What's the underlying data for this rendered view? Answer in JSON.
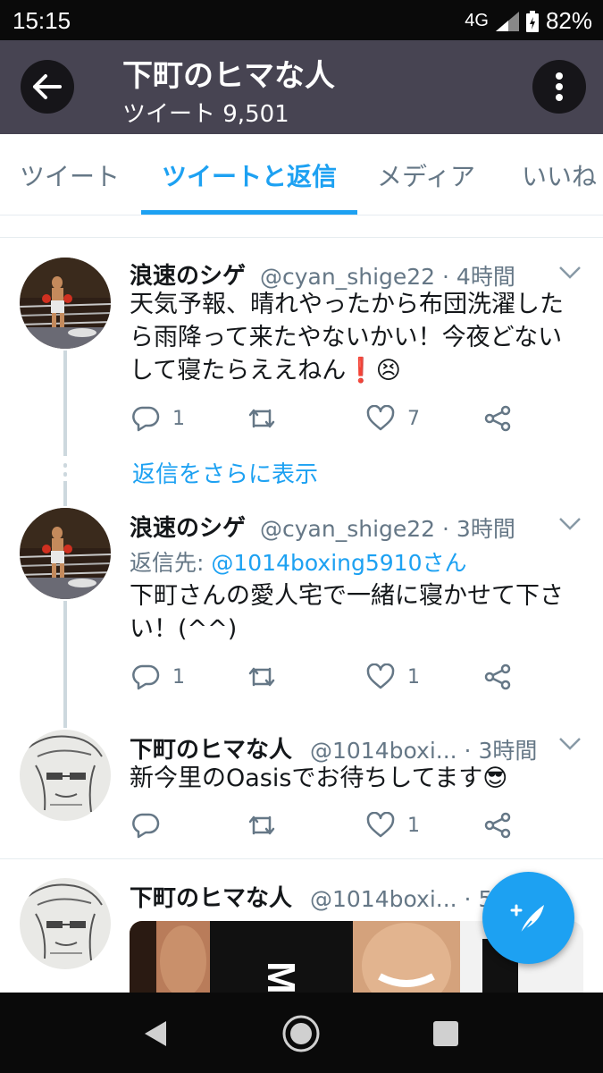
{
  "status_bar": {
    "time": "15:15",
    "network": "4G",
    "battery": "82%"
  },
  "header": {
    "title": "下町のヒマな人",
    "subtitle": "ツイート 9,501"
  },
  "tabs": [
    {
      "label": "ツイート"
    },
    {
      "label": "ツイートと返信"
    },
    {
      "label": "メディア"
    },
    {
      "label": "いいね"
    }
  ],
  "tweets": [
    {
      "name": "浪速のシゲ",
      "handle": "@cyan_shige22 · 4時間",
      "text": "天気予報、晴れやったから布団洗濯したら雨降って来たやないかい！今夜どないして寝たらええねん❗😣",
      "replies": "1",
      "retweets": "",
      "likes": "7"
    },
    {
      "name": "浪速のシゲ",
      "handle": "@cyan_shige22 · 3時間",
      "reply_prefix": "返信先: ",
      "reply_mention": "@1014boxing5910さん",
      "text": "下町さんの愛人宅で一緒に寝かせて下さい！(^^)",
      "replies": "1",
      "retweets": "",
      "likes": "1"
    },
    {
      "name": "下町のヒマな人",
      "handle": "@1014boxi... · 3時間",
      "text": "新今里のOasisでお待ちしてます😎",
      "replies": "",
      "retweets": "",
      "likes": "1"
    },
    {
      "name": "下町のヒマな人",
      "handle": "@1014boxi... · 5時"
    }
  ],
  "more_replies": "返信をさらに表示",
  "colors": {
    "accent": "#1da1f2",
    "header_bg": "#474452",
    "muted": "#657786"
  }
}
